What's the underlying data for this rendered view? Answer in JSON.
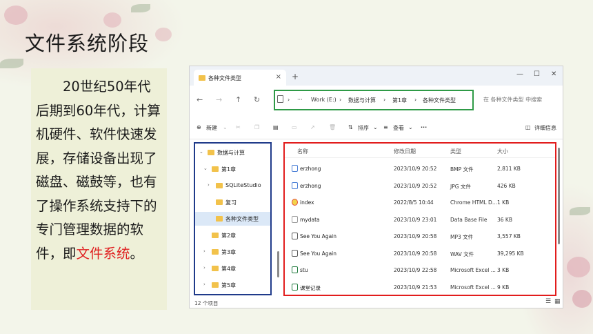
{
  "slide": {
    "title": "文件系统阶段",
    "paragraph_before": "20世纪50年代后期到60年代，计算机硬件、软件快速发展，存储设备出现了磁盘、磁鼓等，也有了操作系统支持下的专门管理数据的软件，即",
    "highlight": "文件系统",
    "paragraph_after": "。",
    "highlight_color": "#e02020"
  },
  "explorer": {
    "tab_title": "各种文件类型",
    "tab_close": "×",
    "new_tab": "+",
    "window_buttons": [
      "—",
      "☐",
      "✕"
    ],
    "nav_buttons": [
      "←",
      "→",
      "↑",
      "↻"
    ],
    "breadcrumb": [
      "Work (E:)",
      "数据与计算",
      "第1章",
      "各种文件类型"
    ],
    "breadcrumb_sep": "›",
    "breadcrumb_more": "···",
    "search_placeholder": "在 各种文件类型 中搜索",
    "toolbar": {
      "new": "新建",
      "sort": "排序",
      "view": "查看",
      "more": "···",
      "details": "详细信息"
    },
    "nav_tree": [
      {
        "label": "数据与计算",
        "chevron": "⌄"
      },
      {
        "label": "第1章",
        "chevron": "⌄"
      },
      {
        "label": "SQLiteStudio",
        "chevron": "›"
      },
      {
        "label": "复习",
        "chevron": ""
      },
      {
        "label": "各种文件类型",
        "chevron": "",
        "selected": true
      },
      {
        "label": "第2章",
        "chevron": ""
      },
      {
        "label": "第3章",
        "chevron": "›"
      },
      {
        "label": "第4章",
        "chevron": "›"
      },
      {
        "label": "第5章",
        "chevron": "›"
      }
    ],
    "columns": {
      "name": "名称",
      "modified": "修改日期",
      "type": "类型",
      "size": "大小"
    },
    "files": [
      {
        "name": "erzhong",
        "modified": "2023/10/9 20:52",
        "type": "BMP 文件",
        "size": "2,811 KB",
        "icon": "image-icon",
        "color": "#4a7fd6"
      },
      {
        "name": "erzhong",
        "modified": "2023/10/9 20:52",
        "type": "JPG 文件",
        "size": "426 KB",
        "icon": "image-icon",
        "color": "#4a7fd6"
      },
      {
        "name": "index",
        "modified": "2022/8/5 10:44",
        "type": "Chrome HTML D...",
        "size": "1 KB",
        "icon": "chrome-icon",
        "color": "#e04a3a"
      },
      {
        "name": "mydata",
        "modified": "2023/10/9 23:01",
        "type": "Data Base File",
        "size": "36 KB",
        "icon": "file-icon",
        "color": "#9a9a9a"
      },
      {
        "name": "See You Again",
        "modified": "2023/10/9 20:58",
        "type": "MP3 文件",
        "size": "3,557 KB",
        "icon": "audio-icon",
        "color": "#5a5a5a"
      },
      {
        "name": "See You Again",
        "modified": "2023/10/9 20:58",
        "type": "WAV 文件",
        "size": "39,295 KB",
        "icon": "audio-icon",
        "color": "#5a5a5a"
      },
      {
        "name": "stu",
        "modified": "2023/10/9 22:58",
        "type": "Microsoft Excel ...",
        "size": "3 KB",
        "icon": "excel-icon",
        "color": "#1f7a3d"
      },
      {
        "name": "课堂记录",
        "modified": "2023/10/9 21:53",
        "type": "Microsoft Excel ...",
        "size": "9 KB",
        "icon": "excel-icon",
        "color": "#1f7a3d"
      }
    ],
    "status": "12 个项目"
  }
}
